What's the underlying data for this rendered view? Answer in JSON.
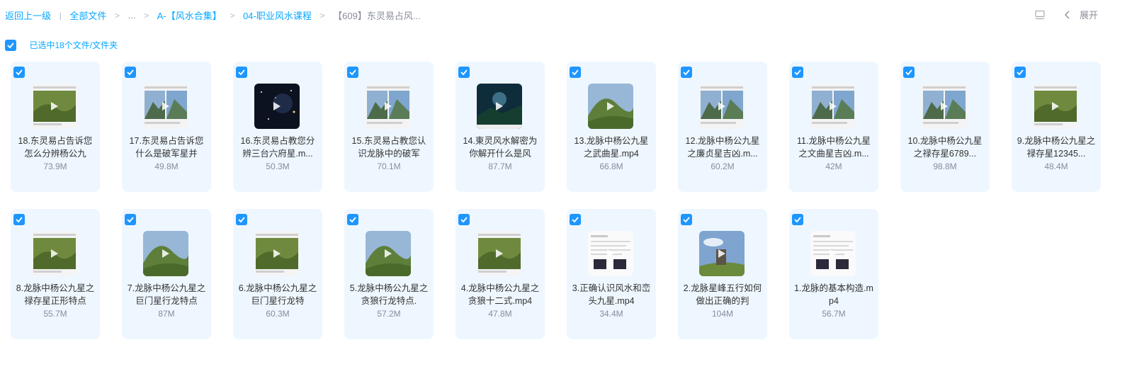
{
  "breadcrumb": {
    "back": "返回上一级",
    "all_files": "全部文件",
    "ellipsis": "...",
    "folder1": "A-【风水合集】",
    "folder2": "04-职业风水课程",
    "current": "【609】东灵易占风..."
  },
  "toolbar": {
    "expand_label": "展开"
  },
  "selection": {
    "label": "已选中18个文件/文件夹"
  },
  "colors": {
    "accent": "#06a7ff",
    "checkbox": "#1e96ff",
    "card_bg": "#eef7ff"
  },
  "files": [
    {
      "name": "18.东灵易占告诉您怎么分辨杨公九",
      "size": "73.9M",
      "thumb": "doc-hill"
    },
    {
      "name": "17.东灵易占告诉您什么是破军星并",
      "size": "49.8M",
      "thumb": "doc-mountain"
    },
    {
      "name": "16.东灵易占教您分辨三台六府星.m...",
      "size": "50.3M",
      "thumb": "space"
    },
    {
      "name": "15.东灵易占教您认识龙脉中的破军",
      "size": "70.1M",
      "thumb": "doc-mountain"
    },
    {
      "name": "14.東灵风水解密为你解开什么是风",
      "size": "87.7M",
      "thumb": "dark-blue"
    },
    {
      "name": "13.龙脉中杨公九星之武曲星.mp4",
      "size": "66.8M",
      "thumb": "green-hill"
    },
    {
      "name": "12.龙脉中杨公九星之廉贞星吉凶.m...",
      "size": "60.2M",
      "thumb": "doc-mountain"
    },
    {
      "name": "11.龙脉中杨公九星之文曲星吉凶.m...",
      "size": "42M",
      "thumb": "doc-mountain"
    },
    {
      "name": "10.龙脉中杨公九星之禄存星6789...",
      "size": "98.8M",
      "thumb": "doc-mountain"
    },
    {
      "name": "9.龙脉中杨公九星之禄存星12345...",
      "size": "48.4M",
      "thumb": "doc-hill"
    },
    {
      "name": "8.龙脉中杨公九星之禄存星正形特点",
      "size": "55.7M",
      "thumb": "doc-hill"
    },
    {
      "name": "7.龙脉中杨公九星之巨门星行龙特点",
      "size": "87M",
      "thumb": "green-hill"
    },
    {
      "name": "6.龙脉中杨公九星之巨门星行龙特",
      "size": "60.3M",
      "thumb": "doc-hill"
    },
    {
      "name": "5.龙脉中杨公九星之贪狼行龙特点.",
      "size": "57.2M",
      "thumb": "green-hill"
    },
    {
      "name": "4.龙脉中杨公九星之贪狼十二式.mp4",
      "size": "47.8M",
      "thumb": "doc-hill"
    },
    {
      "name": "3.正确认识风水和峦头九星.mp4",
      "size": "34.4M",
      "thumb": "doc-text"
    },
    {
      "name": "2.龙脉星峰五行如何做出正确的判",
      "size": "104M",
      "thumb": "rock-sky"
    },
    {
      "name": "1.龙脉的基本构造.mp4",
      "size": "56.7M",
      "thumb": "doc-text"
    }
  ]
}
